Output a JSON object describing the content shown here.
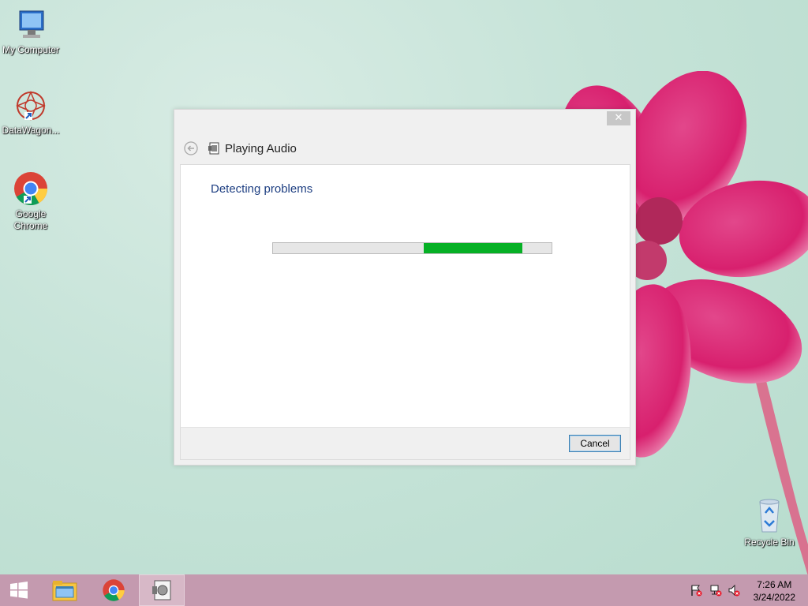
{
  "desktop": {
    "icons": [
      {
        "label": "My Computer",
        "icon": "computer-icon"
      },
      {
        "label": "DataWagon...",
        "icon": "datawagon-icon"
      },
      {
        "label": "Google Chrome",
        "icon": "chrome-icon"
      },
      {
        "label": "Recycle Bin",
        "icon": "recycle-bin-icon"
      }
    ]
  },
  "dialog": {
    "title": "Playing Audio",
    "close_label": "✕",
    "heading": "Detecting problems",
    "progress_fill_start": 0.54,
    "progress_fill_end": 0.895,
    "cancel_label": "Cancel"
  },
  "taskbar": {
    "items": [
      "start-icon",
      "file-explorer-icon",
      "chrome-icon",
      "troubleshooter-icon"
    ],
    "tray": [
      "action-center-flag-icon",
      "network-icon",
      "volume-muted-icon"
    ],
    "time": "7:26 AM",
    "date": "3/24/2022"
  },
  "colors": {
    "accent": "#1e3f82",
    "progress": "#06b025",
    "taskbar": "#c49aaf"
  }
}
